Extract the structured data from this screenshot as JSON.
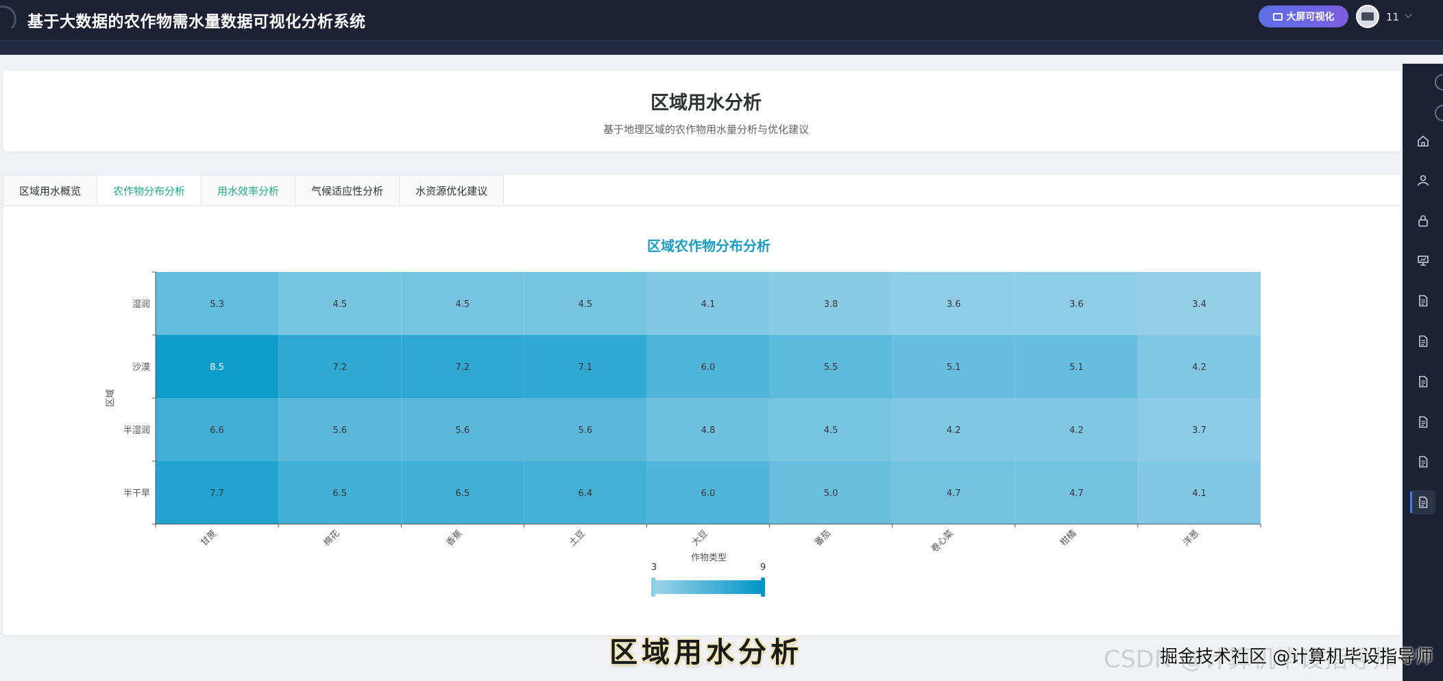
{
  "app": {
    "title": "基于大数据的农作物需水量数据可视化分析系统",
    "screen_button": "大屏可视化",
    "user_name": "11"
  },
  "header": {
    "title": "区域用水分析",
    "subtitle": "基于地理区域的农作物用水量分析与优化建议"
  },
  "tabs": [
    {
      "label": "区域用水概览"
    },
    {
      "label": "农作物分布分析",
      "active": true
    },
    {
      "label": "用水效率分析"
    },
    {
      "label": "气候适应性分析"
    },
    {
      "label": "水资源优化建议"
    }
  ],
  "sidebar_icons": [
    "home-icon",
    "user-icon",
    "lock-icon",
    "presentation-icon",
    "document-icon",
    "document-icon",
    "document-icon",
    "document-icon",
    "document-icon",
    "document-icon"
  ],
  "chart_data": {
    "type": "heatmap",
    "title": "区域农作物分布分析",
    "xlabel": "作物类型",
    "ylabel": "区域",
    "x_categories": [
      "甘蔗",
      "棉花",
      "香蕉",
      "土豆",
      "大豆",
      "番茄",
      "卷心菜",
      "柑橘",
      "洋葱"
    ],
    "y_categories": [
      "湿润",
      "沙漠",
      "半湿润",
      "半干旱"
    ],
    "values": [
      [
        5.3,
        4.5,
        4.5,
        4.5,
        4.1,
        3.8,
        3.6,
        3.6,
        3.4
      ],
      [
        8.5,
        7.2,
        7.2,
        7.1,
        6.0,
        5.5,
        5.1,
        5.1,
        4.2
      ],
      [
        6.6,
        5.6,
        5.6,
        5.6,
        4.8,
        4.5,
        4.2,
        4.2,
        3.7
      ],
      [
        7.7,
        6.5,
        6.5,
        6.4,
        6.0,
        5.0,
        4.7,
        4.7,
        4.1
      ]
    ],
    "visual_map": {
      "min": 3,
      "max": 9,
      "min_label": "3",
      "max_label": "9"
    },
    "colors": {
      "low": "#9fd3ea",
      "high": "#0096c7"
    }
  },
  "overlay": {
    "caption": "区域用水分析",
    "watermark": "CSDN @计算机毕设指导师",
    "watermark_front": "掘金技术社区 @计算机毕设指导师"
  }
}
